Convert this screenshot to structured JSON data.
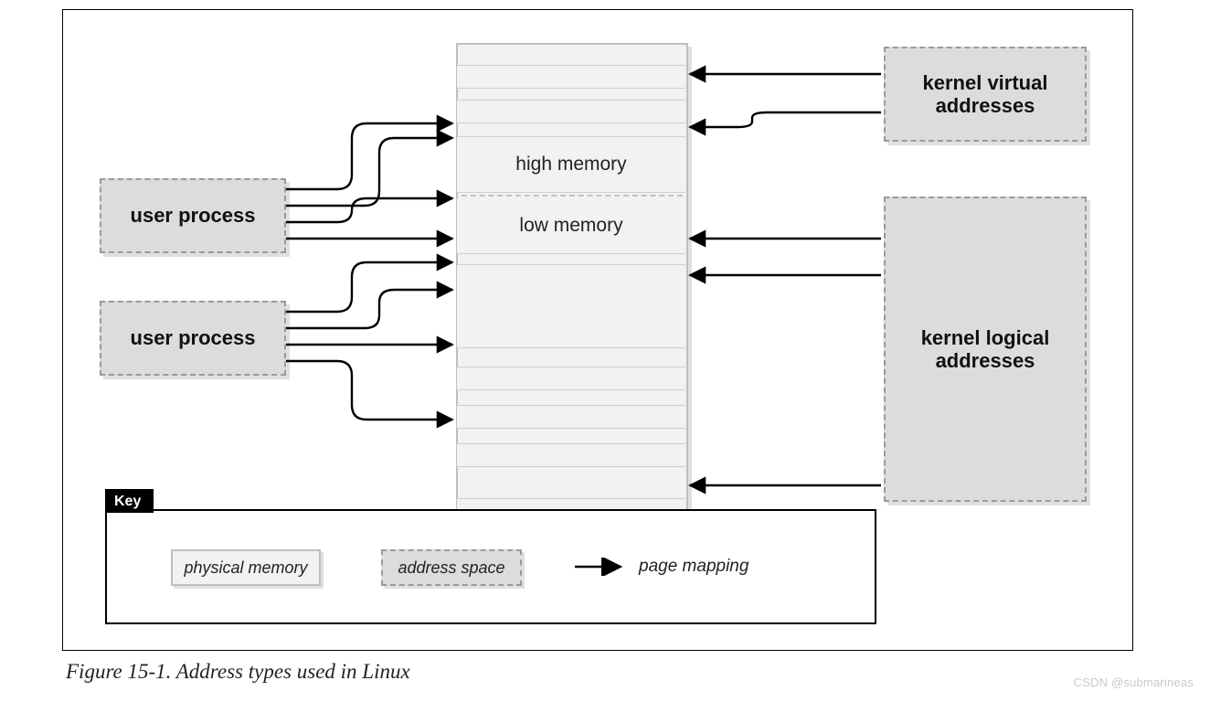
{
  "caption": "Figure 15-1. Address types used in Linux",
  "watermark": "CSDN @submarineas",
  "boxes": {
    "user_process_1": "user process",
    "user_process_2": "user process",
    "kernel_virtual": "kernel virtual\naddresses",
    "kernel_logical": "kernel logical\naddresses"
  },
  "memory": {
    "high": "high memory",
    "low": "low memory"
  },
  "key": {
    "tab": "Key",
    "physical": "physical memory",
    "address_space": "address space",
    "page_mapping": "page mapping"
  },
  "chart_data": {
    "type": "diagram",
    "title": "Address types used in Linux",
    "nodes": [
      {
        "id": "user_process_1",
        "label": "user process",
        "kind": "address-space"
      },
      {
        "id": "user_process_2",
        "label": "user process",
        "kind": "address-space"
      },
      {
        "id": "kernel_virtual",
        "label": "kernel virtual addresses",
        "kind": "address-space"
      },
      {
        "id": "kernel_logical",
        "label": "kernel logical addresses",
        "kind": "address-space"
      },
      {
        "id": "physical_memory",
        "label": "physical memory",
        "kind": "physical-memory",
        "regions": [
          "high memory",
          "low memory"
        ]
      }
    ],
    "edges": [
      {
        "from": "user_process_1",
        "to": "physical_memory",
        "region": "high memory",
        "type": "page mapping"
      },
      {
        "from": "user_process_1",
        "to": "physical_memory",
        "region": "high memory",
        "type": "page mapping"
      },
      {
        "from": "user_process_1",
        "to": "physical_memory",
        "region": "low memory",
        "type": "page mapping"
      },
      {
        "from": "user_process_1",
        "to": "physical_memory",
        "region": "low memory",
        "type": "page mapping"
      },
      {
        "from": "user_process_2",
        "to": "physical_memory",
        "region": "low memory",
        "type": "page mapping"
      },
      {
        "from": "user_process_2",
        "to": "physical_memory",
        "region": "low memory",
        "type": "page mapping"
      },
      {
        "from": "user_process_2",
        "to": "physical_memory",
        "region": "low memory",
        "type": "page mapping"
      },
      {
        "from": "user_process_2",
        "to": "physical_memory",
        "region": "low memory",
        "type": "page mapping"
      },
      {
        "from": "kernel_virtual",
        "to": "physical_memory",
        "region": "high memory",
        "type": "page mapping"
      },
      {
        "from": "kernel_virtual",
        "to": "physical_memory",
        "region": "high memory",
        "type": "page mapping"
      },
      {
        "from": "kernel_logical",
        "to": "physical_memory",
        "region": "low memory",
        "type": "page mapping"
      },
      {
        "from": "kernel_logical",
        "to": "physical_memory",
        "region": "low memory",
        "type": "page mapping"
      },
      {
        "from": "kernel_logical",
        "to": "physical_memory",
        "region": "low memory",
        "type": "page mapping"
      }
    ],
    "legend": [
      {
        "swatch": "solid",
        "label": "physical memory"
      },
      {
        "swatch": "dashed",
        "label": "address space"
      },
      {
        "swatch": "arrow",
        "label": "page mapping"
      }
    ]
  }
}
